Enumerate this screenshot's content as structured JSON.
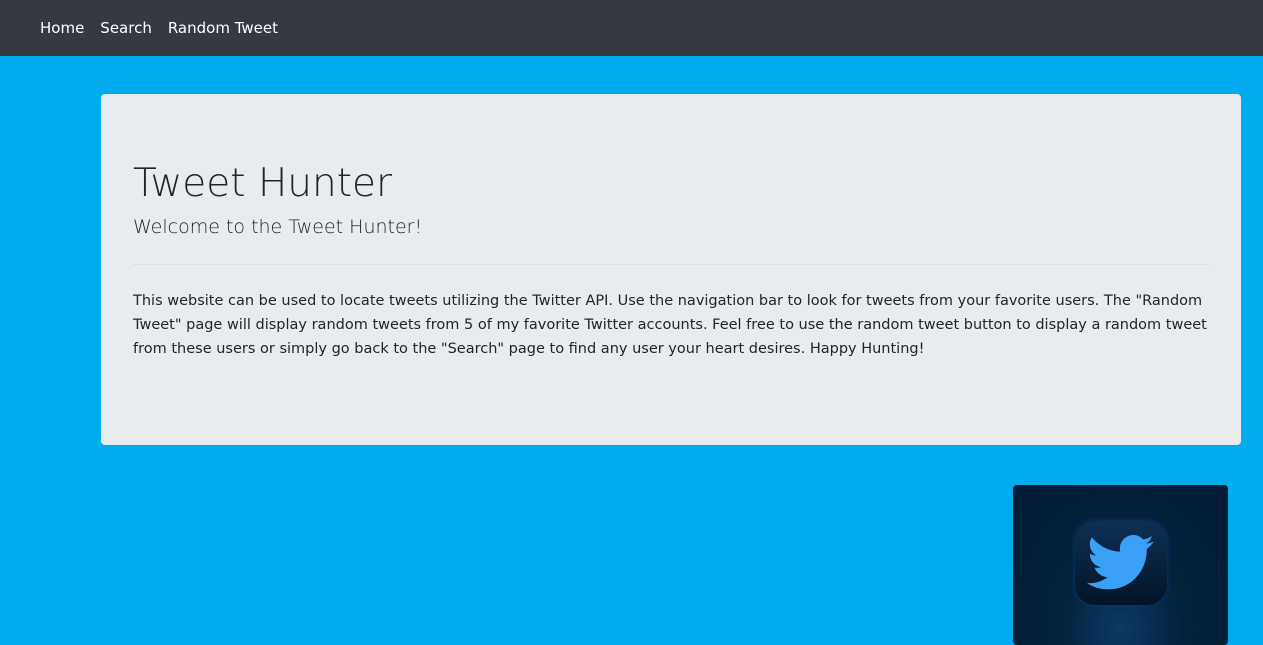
{
  "nav": {
    "items": [
      "Home",
      "Search",
      "Random Tweet"
    ]
  },
  "jumbotron": {
    "title": "Tweet Hunter",
    "subtitle": "Welcome to the Tweet Hunter!",
    "body": "This website can be used to locate tweets utilizing the Twitter API. Use the navigation bar to look for tweets from your favorite users. The \"Random Tweet\" page will display random tweets from 5 of my favorite Twitter accounts. Feel free to use the random tweet button to display a random tweet from these users or simply go back to the \"Search\" page to find any user your heart desires. Happy Hunting!"
  },
  "image": {
    "icon": "twitter-bird-icon"
  },
  "colors": {
    "background": "#00acee",
    "navbar": "#343a40",
    "jumbotron": "#e9ecef"
  }
}
